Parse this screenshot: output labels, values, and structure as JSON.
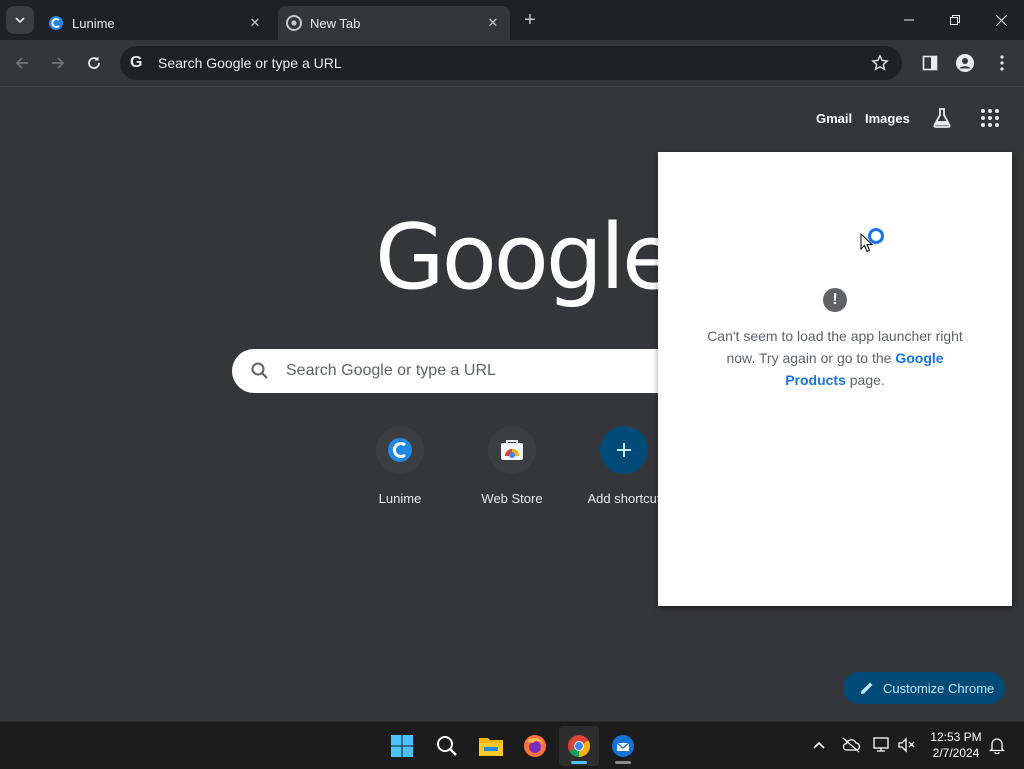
{
  "tabs": [
    {
      "title": "Lunime",
      "favicon": "lunime-icon",
      "active": false
    },
    {
      "title": "New Tab",
      "favicon": "chrome-icon",
      "active": true
    }
  ],
  "toolbar": {
    "omnibox_placeholder": "Search Google or type a URL"
  },
  "ntp": {
    "links": {
      "gmail": "Gmail",
      "images": "Images"
    },
    "logo": "Google",
    "search_placeholder": "Search Google or type a URL",
    "shortcuts": [
      {
        "label": "Lunime",
        "icon": "lunime-icon"
      },
      {
        "label": "Web Store",
        "icon": "web-store-icon"
      },
      {
        "label": "Add shortcut",
        "icon": "plus-icon"
      }
    ],
    "customize_label": "Customize Chrome"
  },
  "launcher": {
    "message_pre": "Can't seem to load the app launcher right now. Try again or go to the ",
    "link_text": "Google Products",
    "message_post": " page."
  },
  "taskbar": {
    "apps": [
      "windows-start-icon",
      "search-icon",
      "file-explorer-icon",
      "firefox-icon",
      "chrome-icon",
      "thunderbird-icon"
    ],
    "clock_time": "12:53 PM",
    "clock_date": "2/7/2024"
  },
  "colors": {
    "page_bg": "#35363a",
    "tabstrip_bg": "#202124",
    "accent": "#1a73e8",
    "customize_bg": "#004a77"
  }
}
